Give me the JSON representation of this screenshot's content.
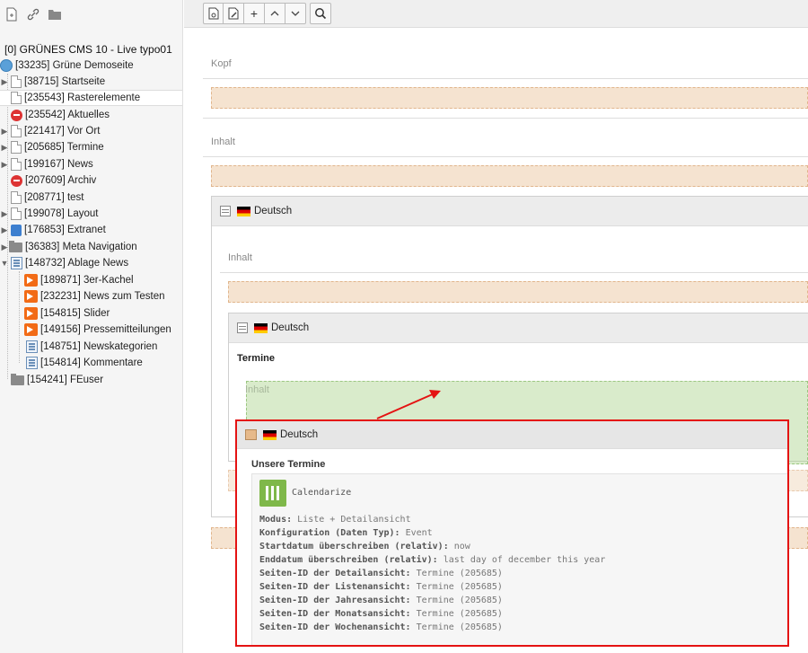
{
  "tree": {
    "root_label": "[0] GRÜNES CMS 10 - Live typo01",
    "site_label": "[33235] Grüne Demoseite",
    "items": [
      {
        "label": "[38715] Startseite"
      },
      {
        "label": "[235543] Rasterelemente"
      },
      {
        "label": "[235542] Aktuelles"
      },
      {
        "label": "[221417] Vor Ort"
      },
      {
        "label": "[205685] Termine"
      },
      {
        "label": "[199167] News"
      },
      {
        "label": "[207609] Archiv"
      },
      {
        "label": "[208771] test"
      },
      {
        "label": "[199078] Layout"
      },
      {
        "label": "[176853] Extranet"
      },
      {
        "label": "[36383] Meta Navigation"
      },
      {
        "label": "[148732] Ablage News"
      },
      {
        "label": "[189871] 3er-Kachel"
      },
      {
        "label": "[232231] News zum Testen"
      },
      {
        "label": "[154815] Slider"
      },
      {
        "label": "[149156] Pressemitteilungen"
      },
      {
        "label": "[148751] Newskategorien"
      },
      {
        "label": "[154814] Kommentare"
      },
      {
        "label": "[154241] FEuser"
      }
    ]
  },
  "content": {
    "col_kopf": "Kopf",
    "col_inhalt": "Inhalt",
    "grid1_lang": "Deutsch",
    "grid1_col": "Inhalt",
    "grid2_lang": "Deutsch",
    "grid2_title": "Termine",
    "ghost_col": "Inhalt",
    "drag": {
      "lang": "Deutsch",
      "title": "Unsere Termine",
      "plugin_name": "Calendarize",
      "lines": [
        {
          "key": "Modus:",
          "value": "Liste + Detailansicht"
        },
        {
          "key": "Konfiguration (Daten Typ):",
          "value": "Event"
        },
        {
          "key": "Startdatum überschreiben (relativ):",
          "value": "now"
        },
        {
          "key": "Enddatum überschreiben (relativ):",
          "value": "last day of december this year"
        },
        {
          "key": "Seiten-ID der Detailansicht:",
          "value": "Termine (205685)"
        },
        {
          "key": "Seiten-ID der Listenansicht:",
          "value": "Termine (205685)"
        },
        {
          "key": "Seiten-ID der Jahresansicht:",
          "value": "Termine (205685)"
        },
        {
          "key": "Seiten-ID der Monatsansicht:",
          "value": "Termine (205685)"
        },
        {
          "key": "Seiten-ID der Wochenansicht:",
          "value": "Termine (205685)"
        }
      ]
    }
  },
  "colors": {
    "highlight": "#e41313",
    "dropzone": "#f5e3d0",
    "ghost": "#aad28c"
  }
}
